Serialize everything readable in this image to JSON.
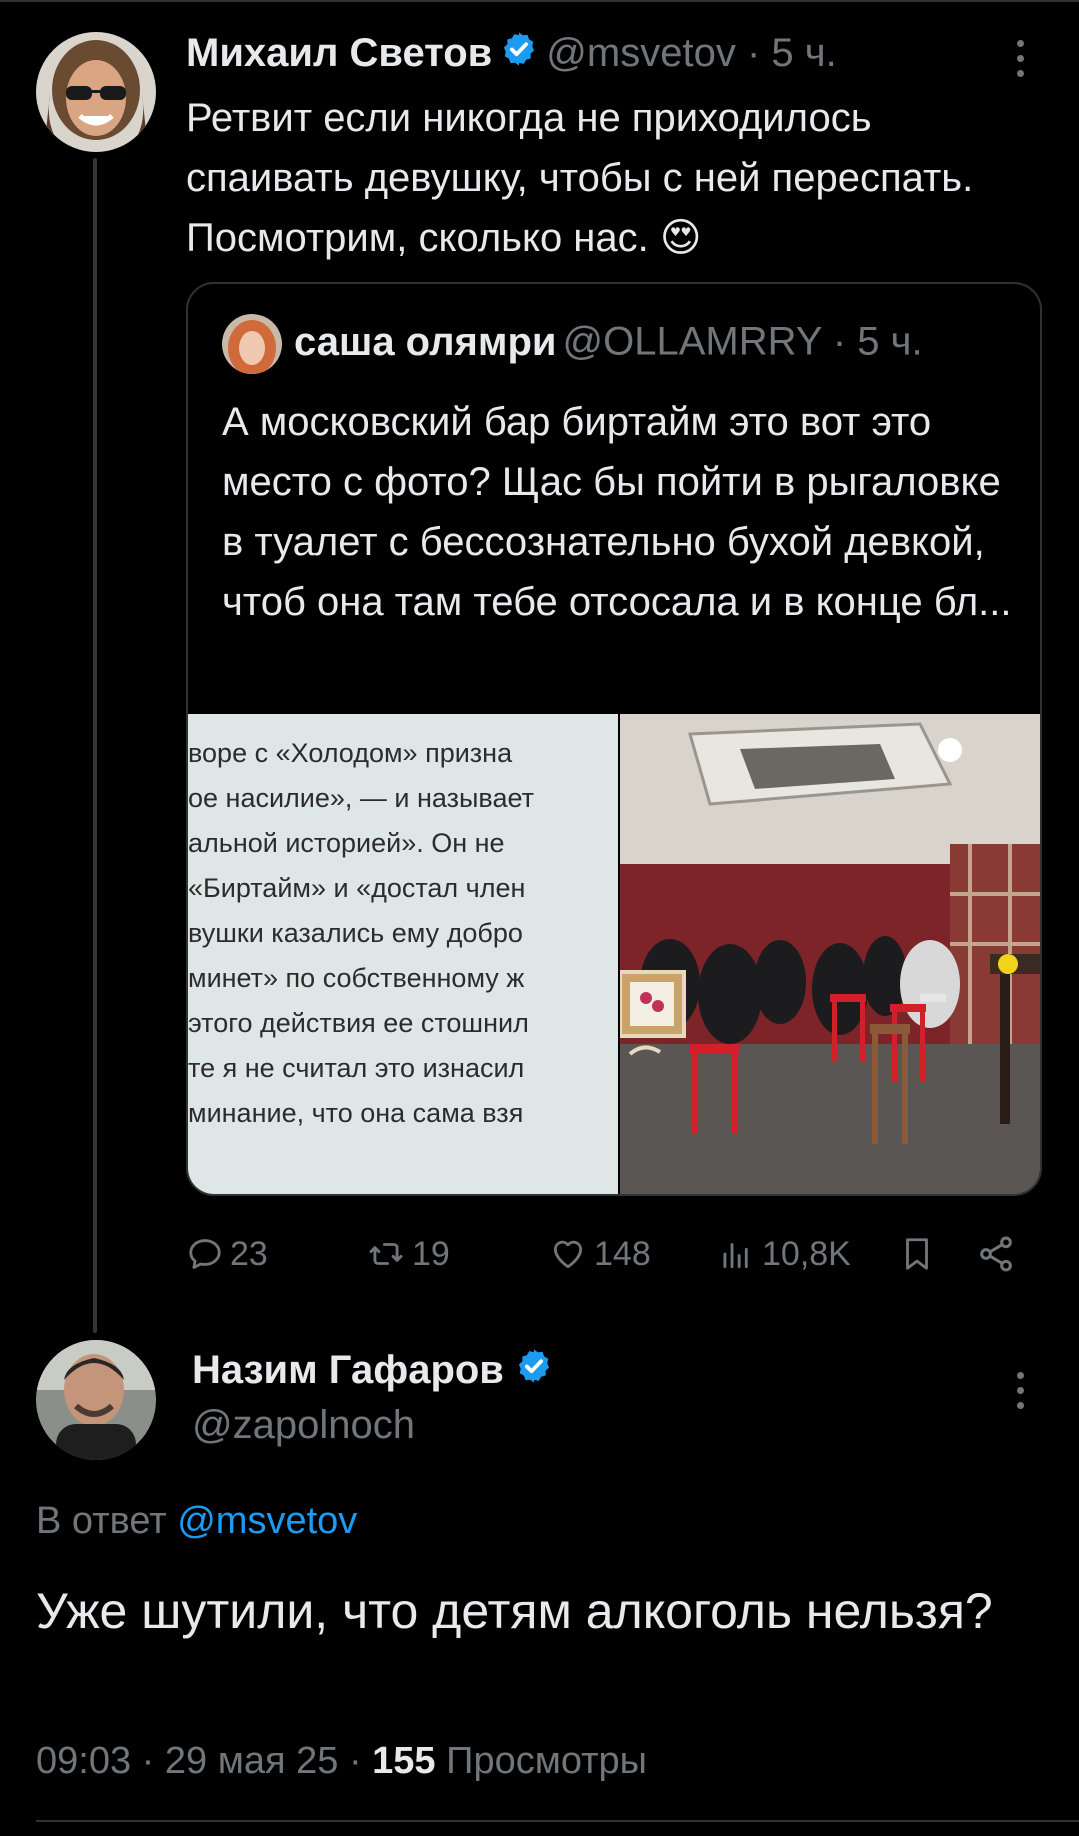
{
  "tweet": {
    "author": {
      "name": "Михаил Светов",
      "handle": "@msvetov"
    },
    "time_ago": "· 5 ч.",
    "text": "Ретвит если никогда не приходилось спаивать девушку, чтобы с ней переспать. Посмотрим, сколько нас.",
    "emoji": "😍",
    "quote": {
      "author": {
        "name": "саша олямри",
        "handle": "@OLLAMRRY"
      },
      "time_ago": "· 5 ч.",
      "text": "А московский бар биртайм это вот это место с фото? Щас бы пойти в рыгаловке в туалет с бессознательно бухой девкой, чтоб она там тебе отсосала и в конце бл...",
      "image_text_lines": [
        "воре с «Холодом» призна",
        "ое насилие», — и называет",
        "альной историей». Он не",
        "«Биртайм» и «достал член",
        "вушки казались ему добро",
        "минет» по собственному ж",
        "этого действия ее стошнил",
        "те я не считал это изнасил",
        "минание, что она сама взя"
      ]
    },
    "stats": {
      "replies": "23",
      "retweets": "19",
      "likes": "148",
      "views": "10,8K"
    }
  },
  "reply": {
    "author": {
      "name": "Назим Гафаров",
      "handle": "@zapolnoch"
    },
    "in_reply_prefix": "В ответ",
    "in_reply_to": "@msvetov",
    "text": "Уже шутили, что детям алкоголь нельзя?",
    "time": "09:03",
    "date": "29 мая 25",
    "views_count": "155",
    "views_label": "Просмотры"
  },
  "colors": {
    "background": "#000000",
    "text": "#e7e9ea",
    "muted": "#71767b",
    "accent": "#1d9bf0",
    "divider": "#2f3336"
  }
}
